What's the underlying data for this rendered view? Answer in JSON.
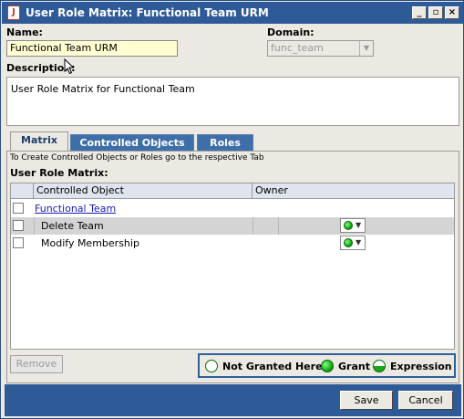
{
  "window": {
    "title": "User Role Matrix: Functional Team URM"
  },
  "form": {
    "name_label": "Name:",
    "name_value": "Functional Team URM",
    "domain_label": "Domain:",
    "domain_value": "func_team",
    "description_label": "Description:",
    "description_value": "User Role Matrix for Functional Team"
  },
  "tabs": [
    {
      "label": "Matrix",
      "active": true
    },
    {
      "label": "Controlled Objects",
      "active": false
    },
    {
      "label": "Roles",
      "active": false
    }
  ],
  "matrix": {
    "hint": "To Create Controlled Objects or Roles go to the respective Tab",
    "title": "User Role Matrix:",
    "columns": [
      "Controlled Object",
      "Owner"
    ],
    "rows": [
      {
        "label": "Functional Team",
        "type": "group-link",
        "grant": ""
      },
      {
        "label": "Delete Team",
        "type": "item",
        "grant": "Grant"
      },
      {
        "label": "Modify Membership",
        "type": "item",
        "grant": "Grant"
      }
    ]
  },
  "actions": {
    "remove_label": "Remove",
    "save_label": "Save",
    "cancel_label": "Cancel"
  },
  "legend": {
    "not_granted": "Not Granted Here",
    "grant": "Grant",
    "expression": "Expression"
  },
  "colors": {
    "accent": "#2e5a97",
    "grant_green": "#0a9a0a",
    "name_field_bg": "#ffffd2"
  }
}
